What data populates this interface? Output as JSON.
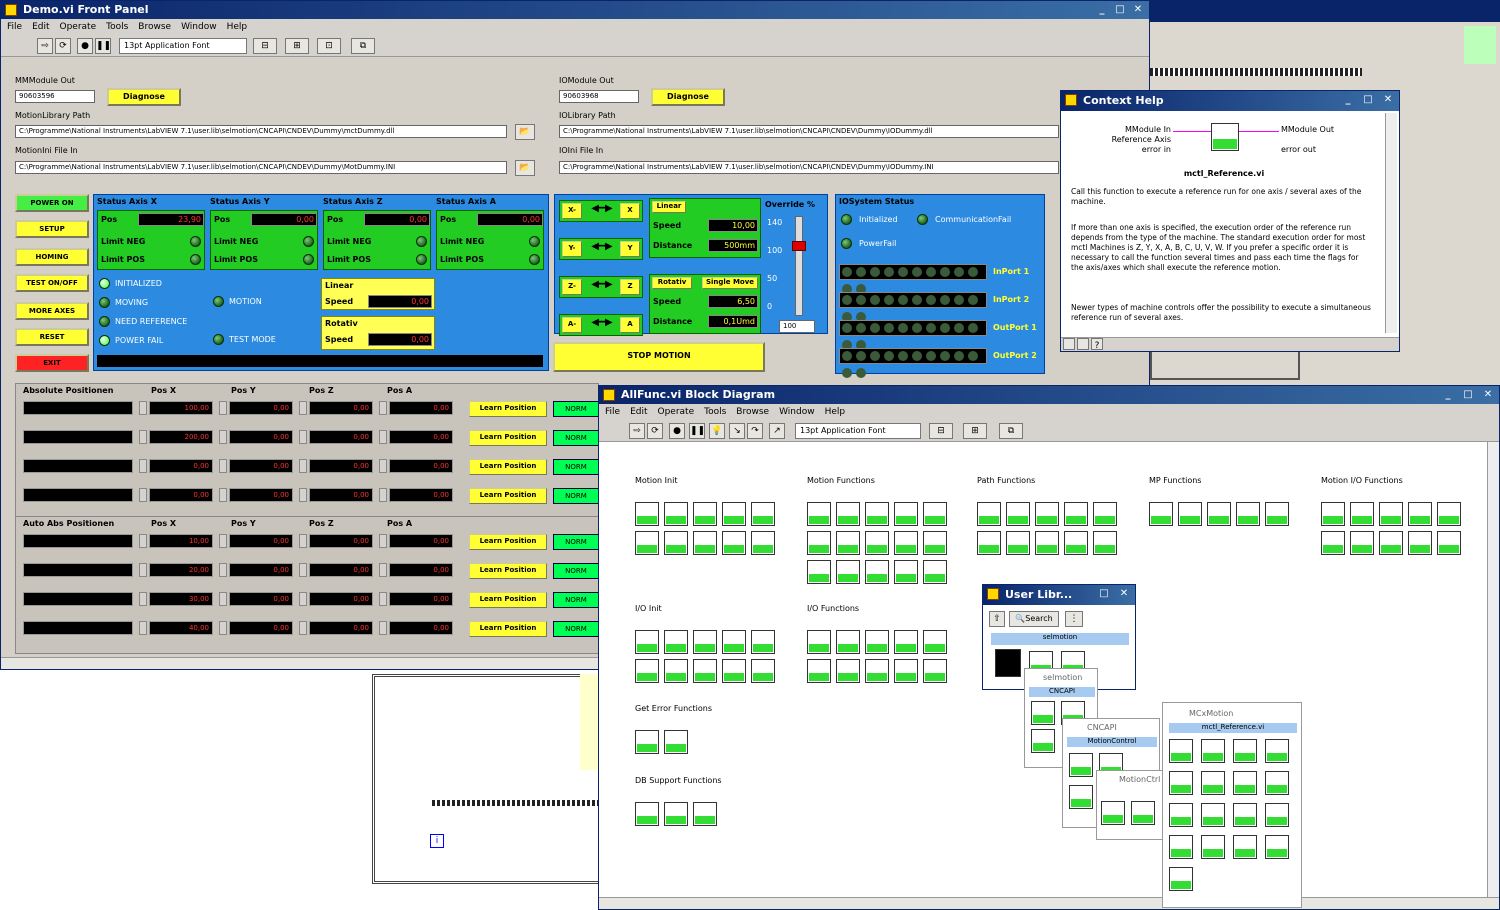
{
  "front_panel": {
    "title": "Demo.vi Front Panel",
    "menu": [
      "File",
      "Edit",
      "Operate",
      "Tools",
      "Browse",
      "Window",
      "Help"
    ],
    "font_select": "13pt Application Font",
    "left_inputs": [
      {
        "label": "MMModule Out",
        "value": "90603596"
      },
      {
        "label": "MotionLibrary Path",
        "value": "C:\\Programme\\National Instruments\\LabVIEW 7.1\\user.lib\\selmotion\\CNCAPI\\CNDEV\\Dummy\\mctDummy.dll"
      },
      {
        "label": "MotionIni File In",
        "value": "C:\\Programme\\National Instruments\\LabVIEW 7.1\\user.lib\\selmotion\\CNCAPI\\CNDEV\\Dummy\\MotDummy.INI"
      }
    ],
    "right_inputs": [
      {
        "label": "IOModule Out",
        "value": "90603968"
      },
      {
        "label": "IOLibrary Path",
        "value": "C:\\Programme\\National Instruments\\LabVIEW 7.1\\user.lib\\selmotion\\CNCAPI\\CNDEV\\Dummy\\IODummy.dll"
      },
      {
        "label": "IOIni File In",
        "value": "C:\\Programme\\National Instruments\\LabVIEW 7.1\\user.lib\\selmotion\\CNCAPI\\CNDEV\\Dummy\\IODummy.INI"
      }
    ],
    "diagnose": "Diagnose",
    "side_buttons": [
      "POWER ON",
      "SETUP",
      "HOMING",
      "TEST ON/OFF",
      "MORE AXES",
      "RESET",
      "EXIT"
    ],
    "axes": [
      {
        "title": "Status Axis X",
        "pos": "23,90"
      },
      {
        "title": "Status Axis Y",
        "pos": "0,00"
      },
      {
        "title": "Status Axis Z",
        "pos": "0,00"
      },
      {
        "title": "Status Axis A",
        "pos": "0,00"
      }
    ],
    "axis_labels": {
      "pos": "Pos",
      "limit_neg": "Limit NEG",
      "limit_pos": "Limit POS"
    },
    "status_leds": [
      "INITIALIZED",
      "MOVING",
      "NEED REFERENCE",
      "POWER FAIL"
    ],
    "status_leds2": [
      "MOTION",
      "TEST MODE"
    ],
    "linear_box": {
      "title": "Linear",
      "speed_label": "Speed",
      "speed": "0,00"
    },
    "rotativ_box": {
      "title": "Rotativ",
      "speed_label": "Speed",
      "speed": "0,00"
    },
    "jog_buttons": [
      [
        "X-",
        "X"
      ],
      [
        "Y-",
        "Y"
      ],
      [
        "Z-",
        "Z"
      ],
      [
        "A-",
        "A"
      ]
    ],
    "linear": {
      "title": "Linear",
      "speed_label": "Speed",
      "speed": "10,00",
      "distance_label": "Distance",
      "distance": "500mm"
    },
    "rotativ": {
      "title": "Rotativ",
      "mode": "Single Move",
      "speed_label": "Speed",
      "speed": "6,50",
      "distance_label": "Distance",
      "distance": "0,1Umd"
    },
    "override": {
      "title": "Override %",
      "ticks": [
        "140",
        "100",
        "50",
        "0"
      ],
      "value": "100"
    },
    "stop": "STOP MOTION",
    "io_status": {
      "title": "IOSystem Status",
      "leds": [
        "Initialized",
        "CommunicationFail",
        "PowerFail"
      ],
      "ports": [
        "InPort 1",
        "InPort 2",
        "OutPort 1",
        "OutPort 2"
      ]
    },
    "abs_section": {
      "title": "Absolute Positionen",
      "cols": [
        "Pos X",
        "Pos Y",
        "Pos Z",
        "Pos A"
      ],
      "rows": [
        [
          "",
          "100,00",
          "0,00",
          "0,00",
          "0,00"
        ],
        [
          "",
          "200,00",
          "0,00",
          "0,00",
          "0,00"
        ],
        [
          "",
          "0,00",
          "0,00",
          "0,00",
          "0,00"
        ],
        [
          "",
          "0,00",
          "0,00",
          "0,00",
          "0,00"
        ]
      ]
    },
    "rel_section": {
      "title": "Auto Abs Positionen",
      "cols": [
        "Pos X",
        "Pos Y",
        "Pos Z",
        "Pos A"
      ],
      "rows": [
        [
          "",
          "10,00",
          "0,00",
          "0,00",
          "0,00"
        ],
        [
          "",
          "20,00",
          "0,00",
          "0,00",
          "0,00"
        ],
        [
          "",
          "30,00",
          "0,00",
          "0,00",
          "0,00"
        ],
        [
          "",
          "40,00",
          "0,00",
          "0,00",
          "0,00"
        ]
      ]
    },
    "learn": "Learn Position",
    "norm": "NORM"
  },
  "context_help": {
    "title": "Context Help",
    "inputs": [
      "MModule In",
      "Reference Axis",
      "error in"
    ],
    "outputs": [
      "MModule Out",
      "error out"
    ],
    "vi_name": "mctl_Reference.vi",
    "paragraphs": [
      "Call this function to execute a reference run for one axis / several axes of the machine.",
      "If more than one axis is specified, the execution order of the reference run depends from the type of the machine. The standard execution order for most mctl Machines is Z, Y, X, A, B, C, U, V, W. If you prefer a specific order it is necessary to call the function several times and pass each time the flags for the axis/axes which shall execute the reference motion.",
      "Newer types of machine controls offer the possibility to execute a simultaneous reference run of several axes."
    ]
  },
  "block_diagram": {
    "title": "AllFunc.vi Block Diagram",
    "menu": [
      "File",
      "Edit",
      "Operate",
      "Tools",
      "Browse",
      "Window",
      "Help"
    ],
    "font_select": "13pt Application Font",
    "groups": [
      "Motion Init",
      "Motion Functions",
      "Path Functions",
      "MP Functions",
      "Motion I/O Functions",
      "I/O Init",
      "I/O Functions",
      "Get Error Functions",
      "DB Support Functions"
    ]
  },
  "user_lib": {
    "title": "User Libr...",
    "search": "Search",
    "tab": "selmotion",
    "sub": [
      "selmotion",
      "CNCAPI",
      "CNCAPI",
      "MotionControl",
      "MotionCtrl"
    ],
    "mc": {
      "title": "MCxMotion",
      "vi": "mctl_Reference.vi"
    }
  }
}
